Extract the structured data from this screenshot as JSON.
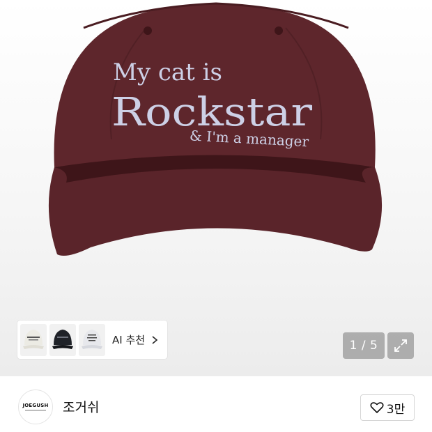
{
  "product_image": {
    "embroidery_line1": "My cat is",
    "embroidery_line2": "Rockstar",
    "embroidery_line3": "& I'm a manager"
  },
  "recommendations": {
    "ai_label": "AI 추천"
  },
  "gallery": {
    "counter": "1 / 5"
  },
  "store": {
    "logo_text": "JOEGUSH",
    "name": "조거쉬",
    "like_count": "3만"
  }
}
